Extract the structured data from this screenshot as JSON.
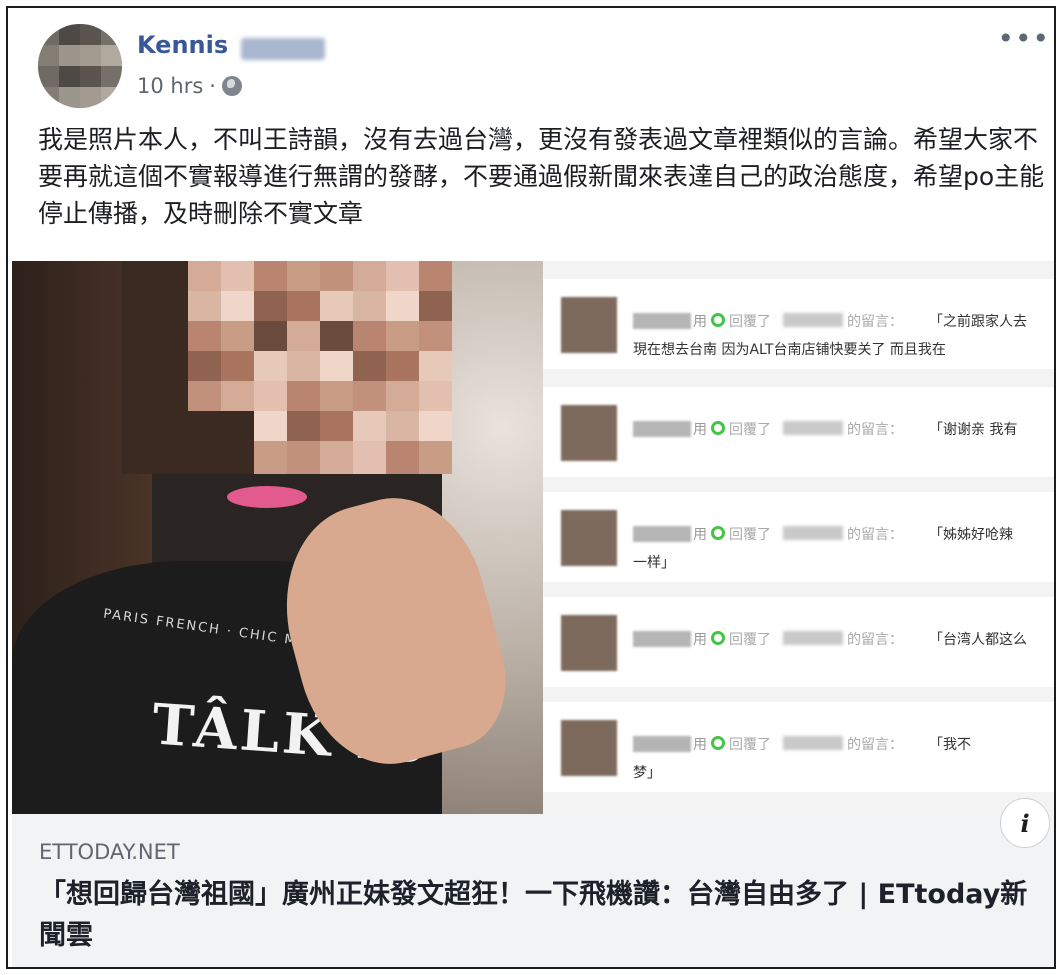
{
  "post": {
    "author": "Kennis",
    "timestamp": "10 hrs",
    "separator": "·",
    "privacy_icon": "globe-icon",
    "more_icon": "more-options-icon",
    "more_label": "•••",
    "text": "我是照片本人，不叫王詩韻，沒有去過台灣，更沒有發表過文章裡類似的言論。希望大家不要再就這個不實報導進行無謂的發酵，不要通過假新聞來表達自己的政治態度，希望po主能停止傳播，及時刪除不實文章"
  },
  "image": {
    "shirt_text_large": "TÂLK ÍS",
    "shirt_text_small": "PARIS FRENCH · CHIC MILAN TALK",
    "comments": [
      {
        "reply": "用",
        "mid": "回覆了",
        "tail": "的留言：",
        "quote": "「之前跟家人去",
        "sub": "現在想去台南 因为ALT台南店铺快要关了 而且我在"
      },
      {
        "reply": "用",
        "mid": "回覆了",
        "tail": "的留言：",
        "quote": "「谢谢亲 我有",
        "sub": ""
      },
      {
        "reply": "用",
        "mid": "回覆了",
        "tail": "的留言：",
        "quote": "「姊姊好呛辣",
        "sub": "一样」"
      },
      {
        "reply": "用",
        "mid": "回覆了",
        "tail": "的留言：",
        "quote": "「台湾人都这么",
        "sub": ""
      },
      {
        "reply": "用",
        "mid": "回覆了",
        "tail": "的留言：",
        "quote": "「我不",
        "sub": "梦」"
      }
    ],
    "info_label": "i"
  },
  "link": {
    "domain": "ETTODAY.NET",
    "headline": "「想回歸台灣祖國」廣州正妹發文超狂！一下飛機讚：台灣自由多了 | ETtoday新聞雲"
  },
  "colors": {
    "author": "#385898",
    "meta": "#606770",
    "link_bg": "#f2f3f5",
    "accent_green": "#45c447"
  }
}
